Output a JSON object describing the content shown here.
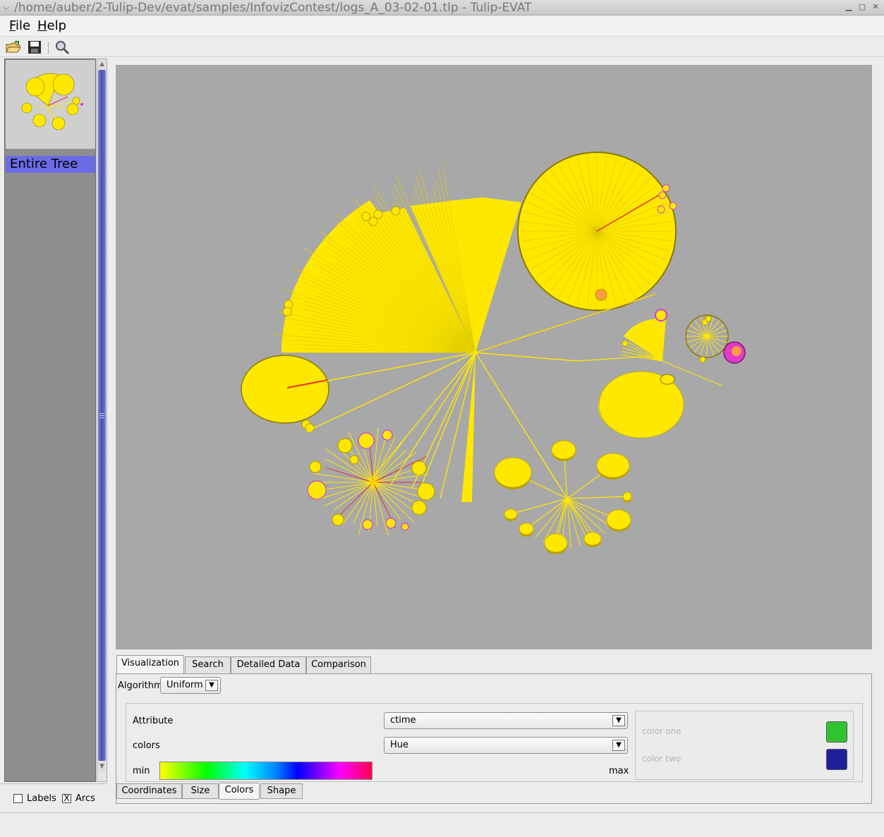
{
  "window": {
    "title": "/home/auber/2-Tulip-Dev/evat/samples/InfovizContest/logs_A_03-02-01.tlp - Tulip-EVAT"
  },
  "menu": {
    "file": "File",
    "help": "Help"
  },
  "toolbar": {
    "icons": [
      "open-folder-icon",
      "save-disk-icon",
      "zoom-magnifier-icon"
    ]
  },
  "tree_panel": {
    "item": "Entire Tree"
  },
  "options": {
    "labels": "Labels",
    "labels_checked": false,
    "arcs": "Arcs",
    "arcs_checked": true,
    "arcs_mark": "X"
  },
  "tabs": [
    "Visualization",
    "Search",
    "Detailed Data",
    "Comparison"
  ],
  "visualization": {
    "algorithm_label": "Algorithm",
    "algorithm_value": "Uniform",
    "attribute_label": "Attribute",
    "attribute_value": "ctime",
    "colors_label": "colors",
    "colors_value": "Hue",
    "min_label": "min",
    "max_label": "max",
    "color_one_label": "color one",
    "color_two_label": "color two",
    "color_one": "#2fc42f",
    "color_two": "#1f1f9a"
  },
  "bottom_tabs": [
    "Coordinates",
    "Size",
    "Colors",
    "Shape"
  ],
  "colors": {
    "canvas_bg": "#a8a8a8",
    "node_yellow": "#ffe800",
    "node_edge": "#b8a000",
    "accent_red": "#e83030",
    "accent_magenta": "#d040d0",
    "selection": "#6b6be6"
  }
}
